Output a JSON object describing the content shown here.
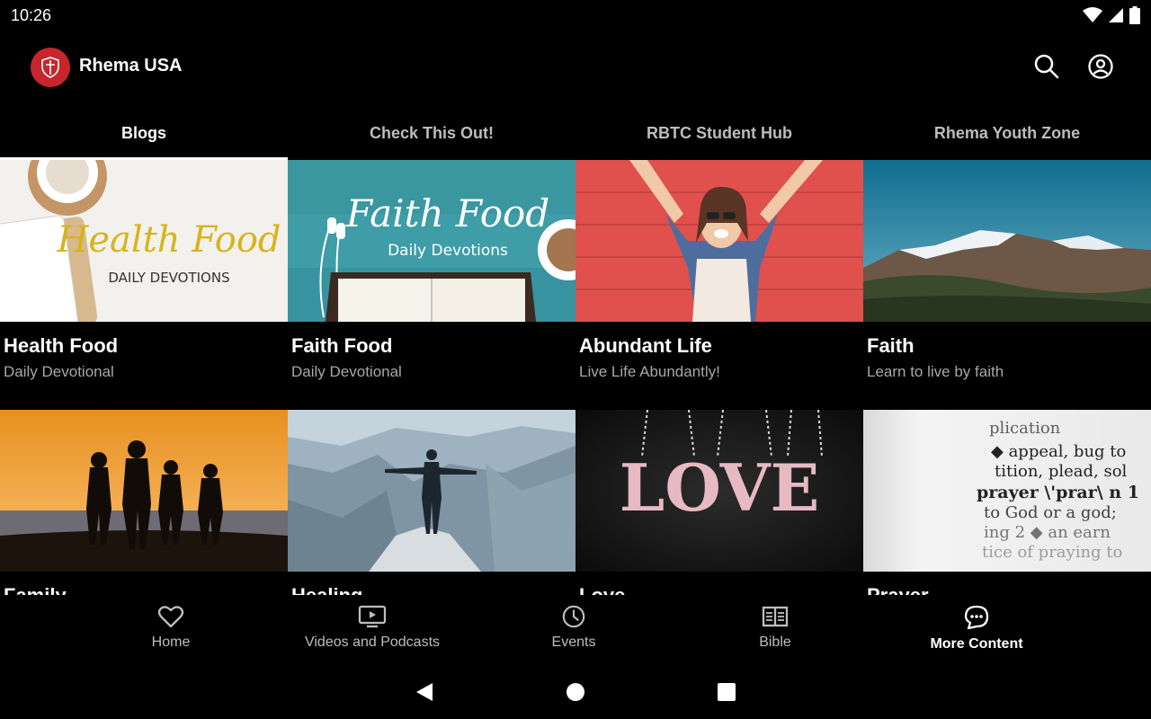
{
  "status": {
    "time": "10:26"
  },
  "app": {
    "title": "Rhema USA"
  },
  "tabs": [
    {
      "label": "Blogs",
      "active": true
    },
    {
      "label": "Check This Out!",
      "active": false
    },
    {
      "label": "RBTC Student Hub",
      "active": false
    },
    {
      "label": "Rhema Youth Zone",
      "active": false
    }
  ],
  "cards": [
    {
      "title": "Health Food",
      "subtitle": "Daily Devotional",
      "image_text": "Health Food",
      "image_sub": "DAILY DEVOTIONS"
    },
    {
      "title": "Faith Food",
      "subtitle": "Daily Devotional",
      "image_text": "Faith Food",
      "image_sub": "Daily Devotions"
    },
    {
      "title": "Abundant Life",
      "subtitle": "Live Life Abundantly!"
    },
    {
      "title": "Faith",
      "subtitle": "Learn to live by faith"
    },
    {
      "title": "Family",
      "subtitle": ""
    },
    {
      "title": "Healing",
      "subtitle": ""
    },
    {
      "title": "Love",
      "subtitle": "",
      "image_text": "LOVE"
    },
    {
      "title": "Prayer",
      "subtitle": "",
      "image_lines": [
        "plication",
        "◆ appeal, bug to",
        "tition, plead, sol",
        "prayer \\'prar\\ n 1",
        "to God or a god;",
        "ing 2 ◆ an earn",
        "tice of praying to"
      ]
    }
  ],
  "nav": [
    {
      "label": "Home",
      "icon": "heart-icon"
    },
    {
      "label": "Videos and Podcasts",
      "icon": "tv-play-icon"
    },
    {
      "label": "Events",
      "icon": "clock-icon"
    },
    {
      "label": "Bible",
      "icon": "book-icon"
    },
    {
      "label": "More Content",
      "icon": "chat-icon",
      "active": true
    }
  ],
  "colors": {
    "brand": "#c8252c",
    "background": "#000000",
    "inactive": "#bdbdbd"
  }
}
